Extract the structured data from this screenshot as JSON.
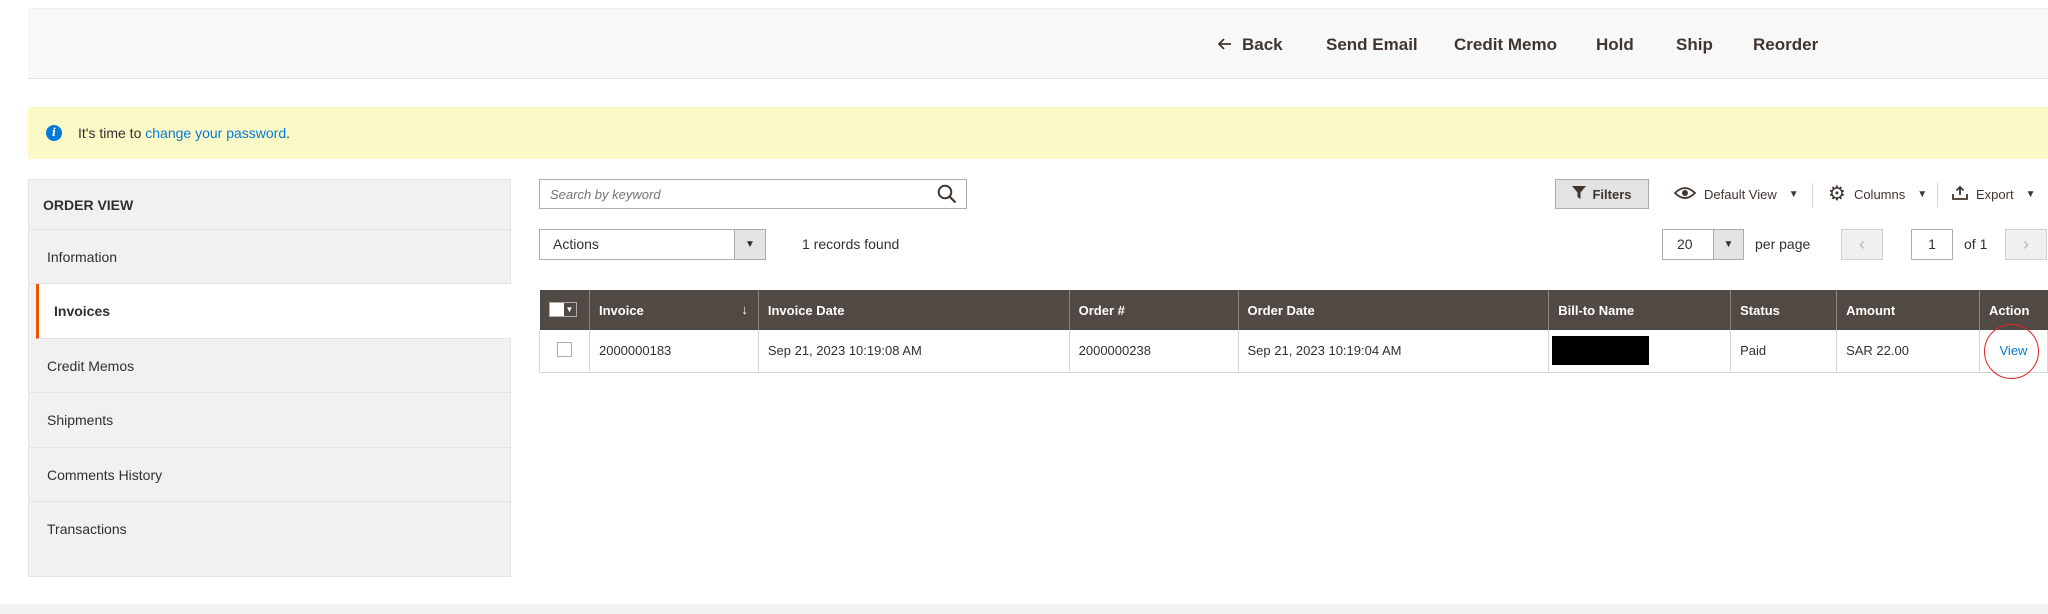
{
  "toolbar": {
    "back": "Back",
    "send_email": "Send Email",
    "credit_memo": "Credit Memo",
    "hold": "Hold",
    "ship": "Ship",
    "reorder": "Reorder"
  },
  "message": {
    "prefix": "It's time to ",
    "link": "change your password",
    "suffix": "."
  },
  "sidebar": {
    "title": "ORDER VIEW",
    "items": [
      {
        "label": "Information"
      },
      {
        "label": "Invoices"
      },
      {
        "label": "Credit Memos"
      },
      {
        "label": "Shipments"
      },
      {
        "label": "Comments History"
      },
      {
        "label": "Transactions"
      }
    ],
    "active_index": 1
  },
  "grid_controls": {
    "search_placeholder": "Search by keyword",
    "filters": "Filters",
    "default_view": "Default View",
    "columns": "Columns",
    "export": "Export",
    "actions": "Actions",
    "records_found": "1 records found",
    "per_page_value": "20",
    "per_page_label": "per page",
    "page_current": "1",
    "page_of": "of 1"
  },
  "table": {
    "columns": [
      "Invoice",
      "Invoice Date",
      "Order #",
      "Order Date",
      "Bill-to Name",
      "Status",
      "Amount",
      "Action"
    ],
    "rows": [
      {
        "invoice": "2000000183",
        "invoice_date": "Sep 21, 2023 10:19:08 AM",
        "order_num": "2000000238",
        "order_date": "Sep 21, 2023 10:19:04 AM",
        "bill_to_name": "",
        "status": "Paid",
        "amount": "SAR 22.00",
        "action": "View"
      }
    ]
  },
  "colors": {
    "header_bg": "#514943",
    "accent": "#eb5202",
    "link": "#007bdb",
    "message_bg": "#fdf9c6",
    "highlight_circle": "#e22626"
  }
}
